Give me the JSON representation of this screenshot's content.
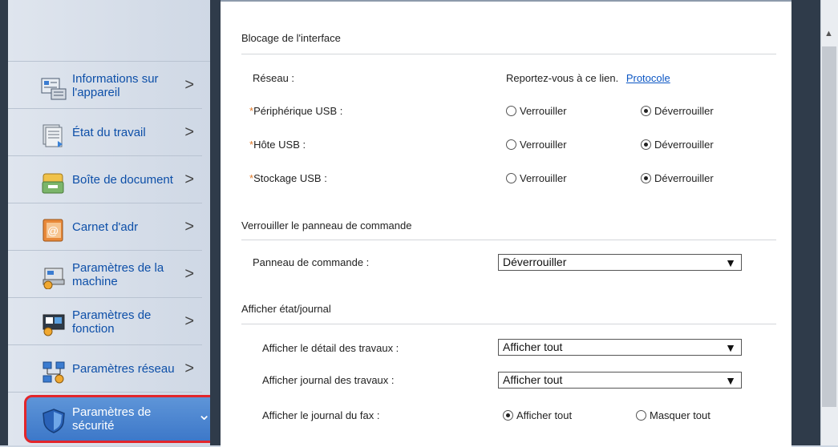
{
  "sidebar": {
    "items": [
      {
        "label": "Informations sur l'appareil",
        "icon": "device-info-icon"
      },
      {
        "label": "État du travail",
        "icon": "job-status-icon"
      },
      {
        "label": "Boîte de document",
        "icon": "document-box-icon"
      },
      {
        "label": "Carnet d'adr",
        "icon": "address-book-icon"
      },
      {
        "label": "Paramètres de la machine",
        "icon": "machine-settings-icon"
      },
      {
        "label": "Paramètres de fonction",
        "icon": "function-settings-icon"
      },
      {
        "label": "Paramètres réseau",
        "icon": "network-settings-icon"
      },
      {
        "label": "Paramètres de sécurité",
        "icon": "security-shield-icon",
        "selected": true
      }
    ],
    "chevron": ">",
    "chevron_down": "⌄"
  },
  "interface_lock": {
    "title": "Blocage de l'interface",
    "network_label": "Réseau :",
    "network_text": "Reportez-vous à ce lien.",
    "network_link": "Protocole",
    "required_mark": "*",
    "usb_device_label": "Périphérique USB :",
    "usb_host_label": "Hôte USB :",
    "usb_storage_label": "Stockage USB :",
    "lock_label": "Verrouiller",
    "unlock_label": "Déverrouiller"
  },
  "panel_lock": {
    "title": "Verrouiller le panneau de commande",
    "panel_label": "Panneau de commande :",
    "panel_value": "Déverrouiller"
  },
  "status_log": {
    "title": "Afficher état/journal",
    "job_detail_label": "Afficher le détail des travaux :",
    "job_detail_value": "Afficher tout",
    "job_log_label": "Afficher journal des travaux :",
    "job_log_value": "Afficher tout",
    "fax_log_label": "Afficher le journal du fax :",
    "fax_show_all": "Afficher tout",
    "fax_hide_all": "Masquer tout"
  },
  "colors": {
    "accent": "#0d4fa8",
    "selected_bg": "#3d78c9",
    "highlight_border": "#e2262b",
    "required": "#e07a2b"
  }
}
